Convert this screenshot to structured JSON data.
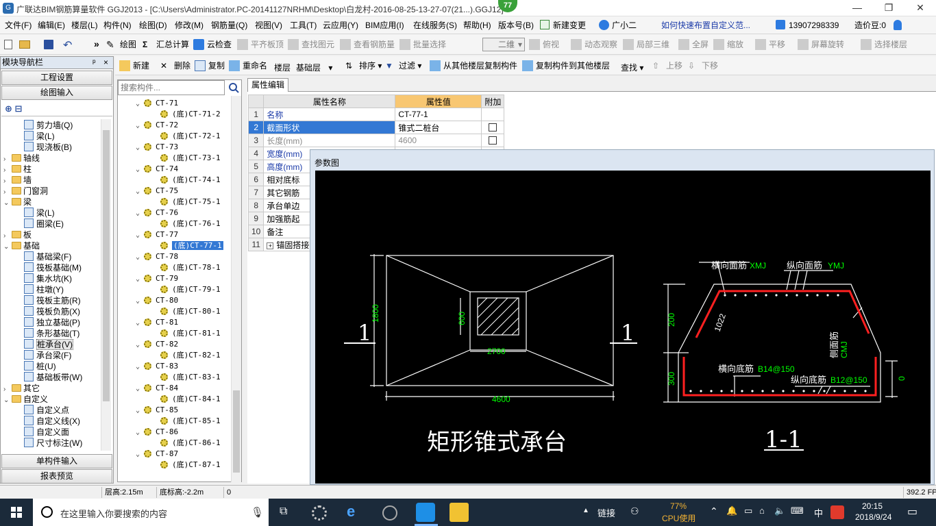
{
  "window": {
    "title": "广联达BIM钢筋算量软件 GGJ2013 - [C:\\Users\\Administrator.PC-20141127NRHM\\Desktop\\白龙村-2016-08-25-13-27-07(21...).GGJ12]",
    "badge": "77",
    "min": "—",
    "max": "❐",
    "close": "✕"
  },
  "menu": [
    "文件(F)",
    "编辑(E)",
    "楼层(L)",
    "构件(N)",
    "绘图(D)",
    "修改(M)",
    "钢筋量(Q)",
    "视图(V)",
    "工具(T)",
    "云应用(Y)",
    "BIM应用(I)",
    "在线服务(S)",
    "帮助(H)",
    "版本号(B)",
    "新建变更",
    "广小二",
    "如何快速布置自定义范...",
    "13907298339",
    "造价豆:0"
  ],
  "toolbar1": {
    "draw": "绘图",
    "calc": "汇总计算",
    "cloud": "云检查",
    "flat": "平齐板顶",
    "find": "查找图元",
    "view_rebar": "查看钢筋量",
    "batch": "批量选择",
    "mode": "二维",
    "top_view": "俯视",
    "dynamic": "动态观察",
    "local3d": "局部三维",
    "fullscreen": "全屏",
    "zoom": "缩放",
    "pan": "平移",
    "rotate": "屏幕旋转",
    "select_floor": "选择楼层"
  },
  "toolbar2": {
    "new": "新建",
    "delete": "删除",
    "copy": "复制",
    "rename": "重命名",
    "floor_label": "楼层",
    "floor_value": "基础层",
    "sort": "排序",
    "filter": "过滤",
    "copy_from": "从其他楼层复制构件",
    "copy_to": "复制构件到其他楼层",
    "find": "查找",
    "up": "上移",
    "down": "下移"
  },
  "nav": {
    "header": "模块导航栏",
    "pin": "ᵖ",
    "close": "×",
    "btn_project": "工程设置",
    "btn_draw": "绘图输入",
    "btn_single": "单构件输入",
    "btn_report": "报表预览",
    "tree": [
      {
        "label": "剪力墙(Q)",
        "level": 2
      },
      {
        "label": "梁(L)",
        "level": 2
      },
      {
        "label": "现浇板(B)",
        "level": 2
      },
      {
        "label": "轴线",
        "level": 1,
        "folder": true,
        "exp": "›"
      },
      {
        "label": "柱",
        "level": 1,
        "folder": true,
        "exp": "›"
      },
      {
        "label": "墙",
        "level": 1,
        "folder": true,
        "exp": "›"
      },
      {
        "label": "门窗洞",
        "level": 1,
        "folder": true,
        "exp": "›"
      },
      {
        "label": "梁",
        "level": 1,
        "folder": true,
        "exp": "⌄"
      },
      {
        "label": "梁(L)",
        "level": 2
      },
      {
        "label": "圈梁(E)",
        "level": 2
      },
      {
        "label": "板",
        "level": 1,
        "folder": true,
        "exp": "›"
      },
      {
        "label": "基础",
        "level": 1,
        "folder": true,
        "exp": "⌄"
      },
      {
        "label": "基础梁(F)",
        "level": 2
      },
      {
        "label": "筏板基础(M)",
        "level": 2
      },
      {
        "label": "集水坑(K)",
        "level": 2
      },
      {
        "label": "柱墩(Y)",
        "level": 2
      },
      {
        "label": "筏板主筋(R)",
        "level": 2
      },
      {
        "label": "筏板负筋(X)",
        "level": 2
      },
      {
        "label": "独立基础(P)",
        "level": 2
      },
      {
        "label": "条形基础(T)",
        "level": 2
      },
      {
        "label": "桩承台(V)",
        "level": 2,
        "sel": true
      },
      {
        "label": "承台梁(F)",
        "level": 2
      },
      {
        "label": "桩(U)",
        "level": 2
      },
      {
        "label": "基础板带(W)",
        "level": 2
      },
      {
        "label": "其它",
        "level": 1,
        "folder": true,
        "exp": "›"
      },
      {
        "label": "自定义",
        "level": 1,
        "folder": true,
        "exp": "⌄"
      },
      {
        "label": "自定义点",
        "level": 2
      },
      {
        "label": "自定义线(X)",
        "level": 2
      },
      {
        "label": "自定义面",
        "level": 2
      },
      {
        "label": "尺寸标注(W)",
        "level": 2
      }
    ]
  },
  "components": {
    "search_placeholder": "搜索构件...",
    "items": [
      {
        "label": "CT-71",
        "child": false
      },
      {
        "label": "(底)CT-71-2",
        "child": true
      },
      {
        "label": "CT-72",
        "child": false
      },
      {
        "label": "(底)CT-72-1",
        "child": true
      },
      {
        "label": "CT-73",
        "child": false
      },
      {
        "label": "(底)CT-73-1",
        "child": true
      },
      {
        "label": "CT-74",
        "child": false
      },
      {
        "label": "(底)CT-74-1",
        "child": true
      },
      {
        "label": "CT-75",
        "child": false
      },
      {
        "label": "(底)CT-75-1",
        "child": true
      },
      {
        "label": "CT-76",
        "child": false
      },
      {
        "label": "(底)CT-76-1",
        "child": true
      },
      {
        "label": "CT-77",
        "child": false
      },
      {
        "label": "(底)CT-77-1",
        "child": true,
        "sel": true
      },
      {
        "label": "CT-78",
        "child": false
      },
      {
        "label": "(底)CT-78-1",
        "child": true
      },
      {
        "label": "CT-79",
        "child": false
      },
      {
        "label": "(底)CT-79-1",
        "child": true
      },
      {
        "label": "CT-80",
        "child": false
      },
      {
        "label": "(底)CT-80-1",
        "child": true
      },
      {
        "label": "CT-81",
        "child": false
      },
      {
        "label": "(底)CT-81-1",
        "child": true
      },
      {
        "label": "CT-82",
        "child": false
      },
      {
        "label": "(底)CT-82-1",
        "child": true
      },
      {
        "label": "CT-83",
        "child": false
      },
      {
        "label": "(底)CT-83-1",
        "child": true
      },
      {
        "label": "CT-84",
        "child": false
      },
      {
        "label": "(底)CT-84-1",
        "child": true
      },
      {
        "label": "CT-85",
        "child": false
      },
      {
        "label": "(底)CT-85-1",
        "child": true
      },
      {
        "label": "CT-86",
        "child": false
      },
      {
        "label": "(底)CT-86-1",
        "child": true
      },
      {
        "label": "CT-87",
        "child": false
      },
      {
        "label": "(底)CT-87-1",
        "child": true
      }
    ]
  },
  "props": {
    "tab": "属性编辑",
    "col_name": "属性名称",
    "col_value": "属性值",
    "col_add": "附加",
    "rows": [
      {
        "n": "1",
        "name": "名称",
        "value": "CT-77-1",
        "chk": false
      },
      {
        "n": "2",
        "name": "截面形状",
        "value": "锥式二桩台",
        "chk": true
      },
      {
        "n": "3",
        "name": "长度(mm)",
        "value": "4600",
        "chk": true
      },
      {
        "n": "4",
        "name": "宽度(mm)",
        "value": ""
      },
      {
        "n": "5",
        "name": "高度(mm)",
        "value": ""
      },
      {
        "n": "6",
        "name": "相对底标",
        "value": ""
      },
      {
        "n": "7",
        "name": "其它钢筋",
        "value": ""
      },
      {
        "n": "8",
        "name": "承台单边",
        "value": ""
      },
      {
        "n": "9",
        "name": "加强筋起",
        "value": ""
      },
      {
        "n": "10",
        "name": "备注",
        "value": ""
      },
      {
        "n": "11",
        "name": "锚固搭接",
        "value": "",
        "plus": "+"
      }
    ]
  },
  "param": {
    "caption": "参数图",
    "plan": {
      "dim_width": "4600",
      "dim_height": "1800",
      "dim_col": "600",
      "dim_inner": "2700",
      "section_left": "1",
      "section_right": "1",
      "title": "矩形锥式承台"
    },
    "section": {
      "top_x": "横向面筋",
      "top_x_code": "XMJ",
      "top_y": "纵向面筋",
      "top_y_code": "YMJ",
      "slope": "1022",
      "side": "侧面筋",
      "side_code": "CMJ",
      "bot_x": "横向底筋",
      "bot_x_val": "B14@150",
      "bot_y": "纵向底筋",
      "bot_y_val": "B12@150",
      "h_top": "200",
      "h_bot": "300",
      "h_right": "0",
      "title": "1-1"
    }
  },
  "status": {
    "floor_h": "层高:2.15m",
    "base_h": "底标高:-2.2m",
    "zero": "0",
    "fps": "392.2 FPS"
  },
  "taskbar": {
    "search": "在这里输入你要搜索的内容",
    "link": "链接",
    "cpu": "77%",
    "cpu_label": "CPU使用",
    "ime": "中",
    "time": "20:15",
    "date": "2018/9/24"
  },
  "colors": {
    "accent": "#3378d4",
    "value_hdr": "#f8c772",
    "green": "#00ff00",
    "rebar": "#ff2020"
  }
}
